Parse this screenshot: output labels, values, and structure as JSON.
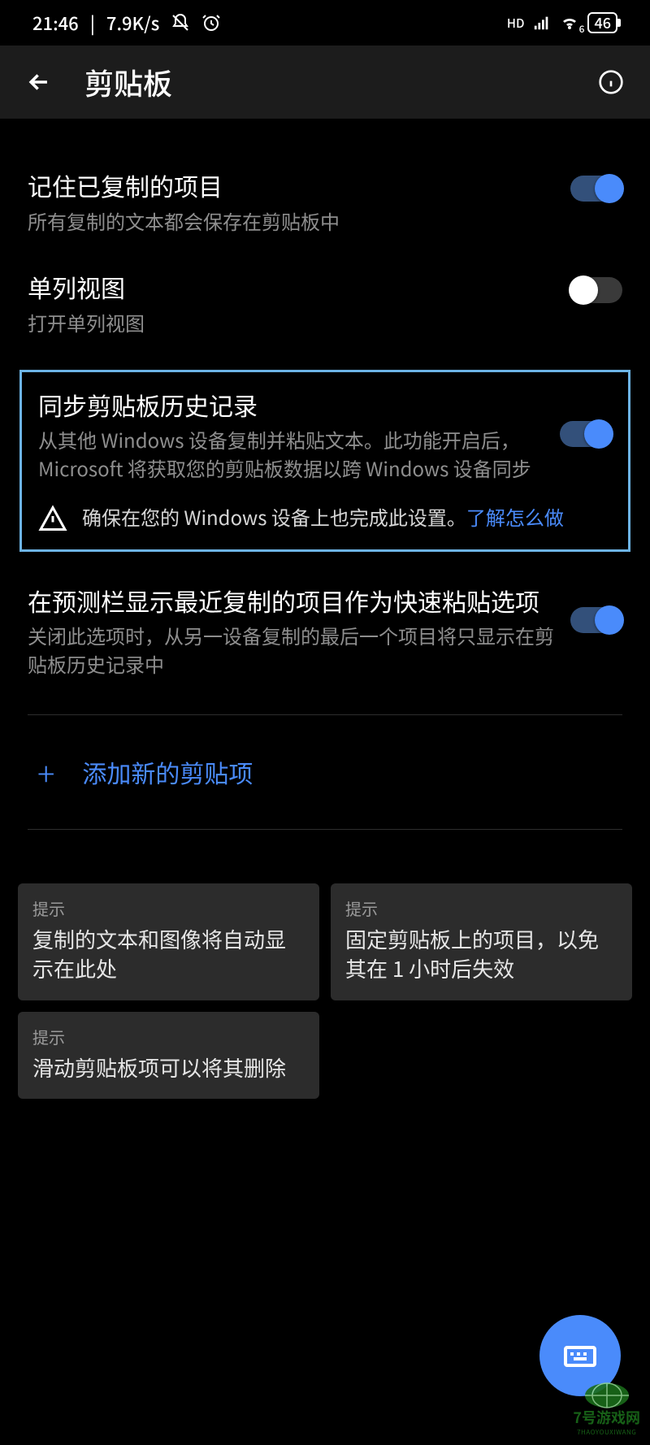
{
  "status": {
    "time": "21:46",
    "speed": "7.9K/s",
    "hd": "HD",
    "wifi_sub": "6",
    "battery": "46"
  },
  "header": {
    "title": "剪贴板"
  },
  "settings": {
    "remember": {
      "title": "记住已复制的项目",
      "desc": "所有复制的文本都会保存在剪贴板中",
      "on": true
    },
    "single": {
      "title": "单列视图",
      "desc": "打开单列视图",
      "on": false
    },
    "sync": {
      "title": "同步剪贴板历史记录",
      "desc": "从其他 Windows 设备复制并粘贴文本。此功能开启后，Microsoft 将获取您的剪贴板数据以跨 Windows 设备同步",
      "on": true,
      "warning_prefix": "确保在您的 Windows 设备上也完成此设置。",
      "warning_link": "了解怎么做"
    },
    "predict": {
      "title": "在预测栏显示最近复制的项目作为快速粘贴选项",
      "desc": "关闭此选项时，从另一设备复制的最后一个项目将只显示在剪贴板历史记录中",
      "on": true
    }
  },
  "add_item": "添加新的剪贴项",
  "tips": {
    "label": "提示",
    "items": [
      "复制的文本和图像将自动显示在此处",
      "固定剪贴板上的项目，以免其在 1 小时后失效",
      "滑动剪贴板项可以将其删除"
    ]
  },
  "watermark": {
    "brand": "7号游戏网",
    "sub": "7HAOYOUXIWANG"
  }
}
